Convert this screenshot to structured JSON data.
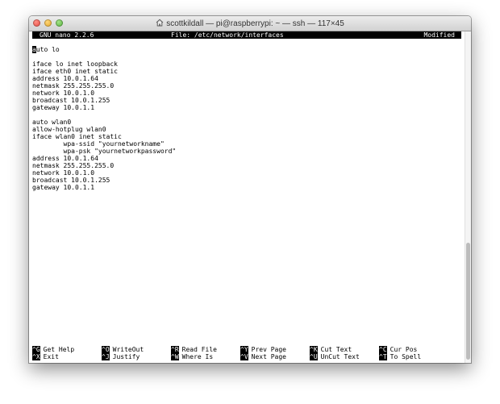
{
  "window": {
    "title": "scottkildall — pi@raspberrypi: ~ — ssh — 117×45"
  },
  "nano": {
    "version": "GNU nano 2.2.6",
    "file": "File: /etc/network/interfaces",
    "status": "Modified"
  },
  "file_lines": [
    "auto lo",
    "",
    "iface lo inet loopback",
    "iface eth0 inet static",
    "address 10.0.1.64",
    "netmask 255.255.255.0",
    "network 10.0.1.0",
    "broadcast 10.0.1.255",
    "gateway 10.0.1.1",
    "",
    "auto wlan0",
    "allow-hotplug wlan0",
    "iface wlan0 inet static",
    "        wpa-ssid \"yournetworkname\"",
    "        wpa-psk \"yournetworkpassword\"",
    "address 10.0.1.64",
    "netmask 255.255.255.0",
    "network 10.0.1.0",
    "broadcast 10.0.1.255",
    "gateway 10.0.1.1"
  ],
  "shortcuts": [
    {
      "key": "^G",
      "label": "Get Help"
    },
    {
      "key": "^O",
      "label": "WriteOut"
    },
    {
      "key": "^R",
      "label": "Read File"
    },
    {
      "key": "^Y",
      "label": "Prev Page"
    },
    {
      "key": "^K",
      "label": "Cut Text"
    },
    {
      "key": "^C",
      "label": "Cur Pos"
    },
    {
      "key": "^X",
      "label": "Exit"
    },
    {
      "key": "^J",
      "label": "Justify"
    },
    {
      "key": "^W",
      "label": "Where Is"
    },
    {
      "key": "^V",
      "label": "Next Page"
    },
    {
      "key": "^U",
      "label": "UnCut Text"
    },
    {
      "key": "^T",
      "label": "To Spell"
    }
  ]
}
